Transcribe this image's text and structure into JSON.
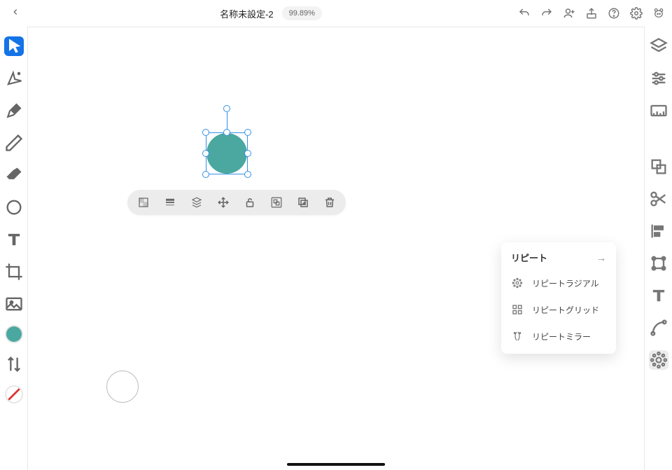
{
  "header": {
    "title": "名称未設定-2",
    "zoom": "99.89%"
  },
  "popover": {
    "title": "リピート",
    "items": [
      {
        "label": "リピートラジアル"
      },
      {
        "label": "リピートグリッド"
      },
      {
        "label": "リピートミラー"
      }
    ]
  },
  "colors": {
    "fill": "#4aa8a0",
    "selection": "#3291e8"
  }
}
